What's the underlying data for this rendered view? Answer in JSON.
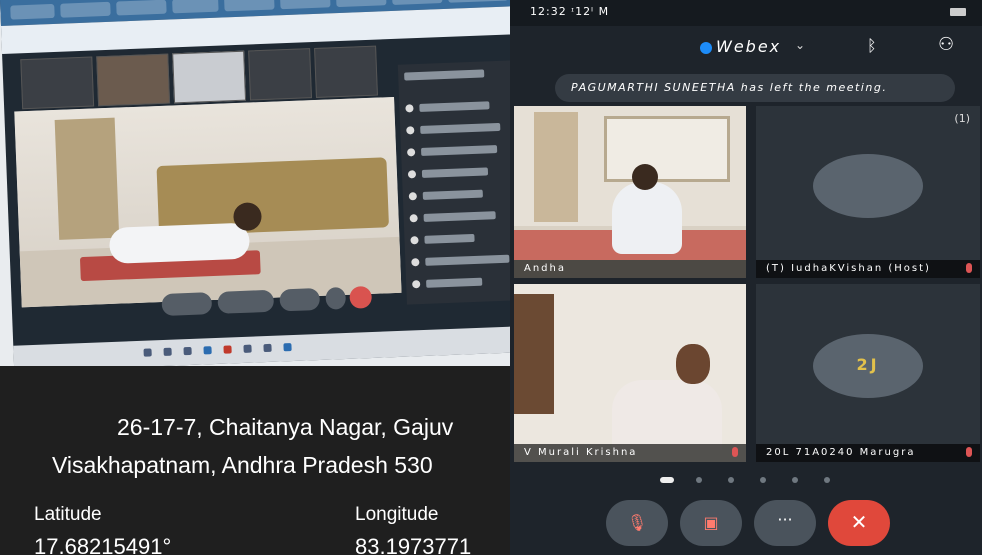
{
  "location": {
    "address_line1": "26-17-7, Chaitanya Nagar, Gajuv",
    "address_line2": "Visakhapatnam, Andhra Pradesh 530",
    "latitude_label": "Latitude",
    "latitude_value": "17.68215491°",
    "longitude_label": "Longitude",
    "longitude_value": "83.1973771"
  },
  "phone": {
    "status_time": "12:32 ᶦ12ᴵ M",
    "app_title": "Webex",
    "notification": "PAGUMARTHI SUNEETHA has left the meeting.",
    "participant_count": "(1)",
    "tiles": [
      {
        "label": "Andha",
        "avatar": ""
      },
      {
        "label": "(T) IudhaKVishan (Host)",
        "avatar": ""
      },
      {
        "label": "V Murali Krishna",
        "avatar": ""
      },
      {
        "label": "20L 71A0240 Marugra",
        "avatar": "2J"
      }
    ],
    "controls": {
      "mute_icon": "mic-off-icon",
      "video_icon": "video-off-icon",
      "more_label": "···",
      "end_label": "✕"
    }
  }
}
